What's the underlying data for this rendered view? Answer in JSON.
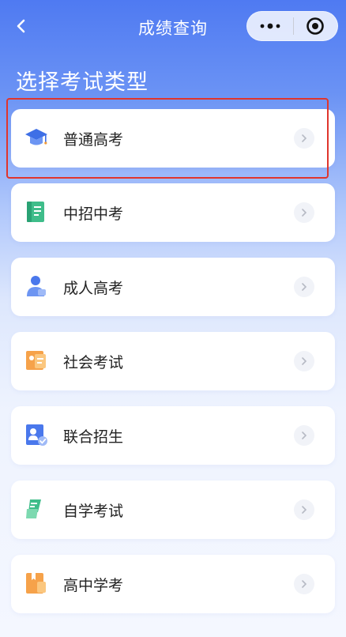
{
  "nav": {
    "title": "成绩查询",
    "back_icon": "chevron-left-icon",
    "more_icon": "more-dots-icon",
    "close_icon": "target-close-icon"
  },
  "heading": "选择考试类型",
  "colors": {
    "accent": "#4f7af2",
    "highlight": "#e0352c"
  },
  "exam_types": [
    {
      "label": "普通高考",
      "icon": "graduation-cap-icon"
    },
    {
      "label": "中招中考",
      "icon": "green-book-icon"
    },
    {
      "label": "成人高考",
      "icon": "adult-person-icon"
    },
    {
      "label": "社会考试",
      "icon": "certificate-icon"
    },
    {
      "label": "联合招生",
      "icon": "id-card-check-icon"
    },
    {
      "label": "自学考试",
      "icon": "pen-tag-icon"
    },
    {
      "label": "高中学考",
      "icon": "folder-book-icon"
    }
  ]
}
